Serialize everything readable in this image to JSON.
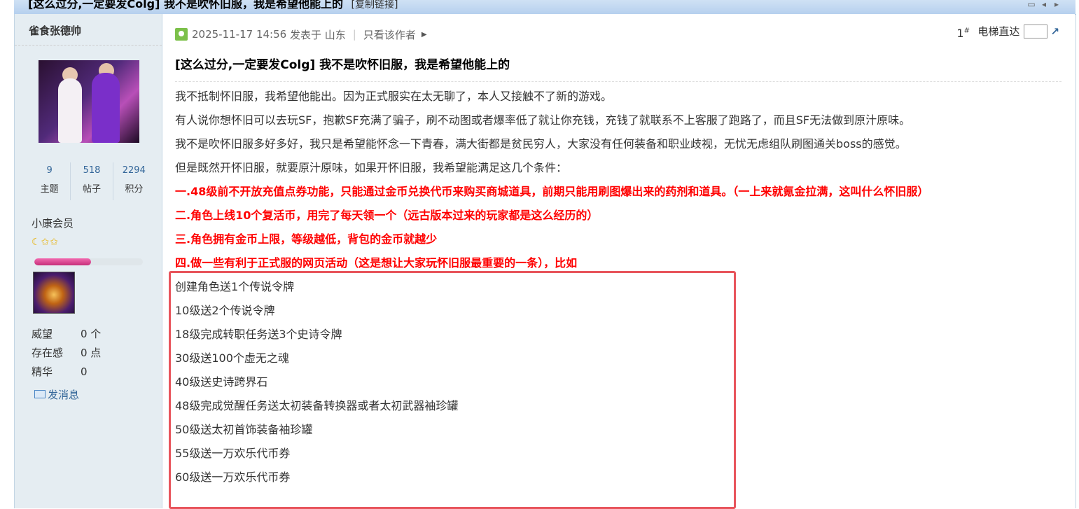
{
  "thread": {
    "title": "[这么过分,一定要发Colg] 我不是吹怀旧服，我是希望他能上的",
    "copy_link": "[复制链接]"
  },
  "author": {
    "name": "雀食张德帅",
    "stats": [
      {
        "value": "9",
        "label": "主题"
      },
      {
        "value": "518",
        "label": "帖子"
      },
      {
        "value": "2294",
        "label": "积分"
      }
    ],
    "group": "小康会员",
    "stars": "☾✩✩",
    "level_progress": 0.52,
    "profile": [
      {
        "key": "威望",
        "value": "0 个"
      },
      {
        "key": "存在感",
        "value": "0 点"
      },
      {
        "key": "精华",
        "value": "0"
      }
    ],
    "send_message": "发消息"
  },
  "post": {
    "datetime": "2025-11-17 14:56",
    "posted_in": "发表于 山东",
    "only_author": "只看该作者",
    "floor": "1",
    "floor_mark": "#",
    "elevator": "电梯直达",
    "title": "[这么过分,一定要发Colg] 我不是吹怀旧服，我是希望他能上的",
    "paragraphs": [
      "我不抵制怀旧服，我希望他能出。因为正式服实在太无聊了，本人又接触不了新的游戏。",
      "有人说你想怀旧可以去玩SF，抱歉SF充满了骗子，刷不动图或者爆率低了就让你充钱，充钱了就联系不上客服了跑路了，而且SF无法做到原汁原味。",
      "我不是吹怀旧服多好多好，我只是希望能怀念一下青春，满大街都是贫民穷人，大家没有任何装备和职业歧视，无忧无虑组队刷图通关boss的感觉。",
      "但是既然开怀旧服，就要原汁原味，如果开怀旧服，我希望能满足这几个条件："
    ],
    "rules": [
      "一.48级前不开放充值点券功能，只能通过金币兑换代币来购买商城道具，前期只能用刷图爆出来的药剂和道具。（一上来就氪金拉满，这叫什么怀旧服）",
      "二.角色上线10个复活币，用完了每天领一个（远古版本过来的玩家都是这么经历的）",
      "三.角色拥有金币上限，等级越低，背包的金币就越少",
      "四.做一些有利于正式服的网页活动（这是想让大家玩怀旧服最重要的一条），比如"
    ],
    "rewards": [
      "创建角色送1个传说令牌",
      "10级送2个传说令牌",
      "18级完成转职任务送3个史诗令牌",
      "30级送100个虚无之魂",
      "40级送史诗跨界石",
      "48级完成觉醒任务送太初装备转换器或者太初武器袖珍罐",
      "50级送太初首饰装备袖珍罐",
      "55级送一万欢乐代币券",
      "60级送一万欢乐代币券"
    ]
  },
  "colors": {
    "highlight_border": "#e8555c",
    "rule_text": "#ff0000",
    "link": "#336699",
    "sidebar_bg": "#e5edf2"
  }
}
